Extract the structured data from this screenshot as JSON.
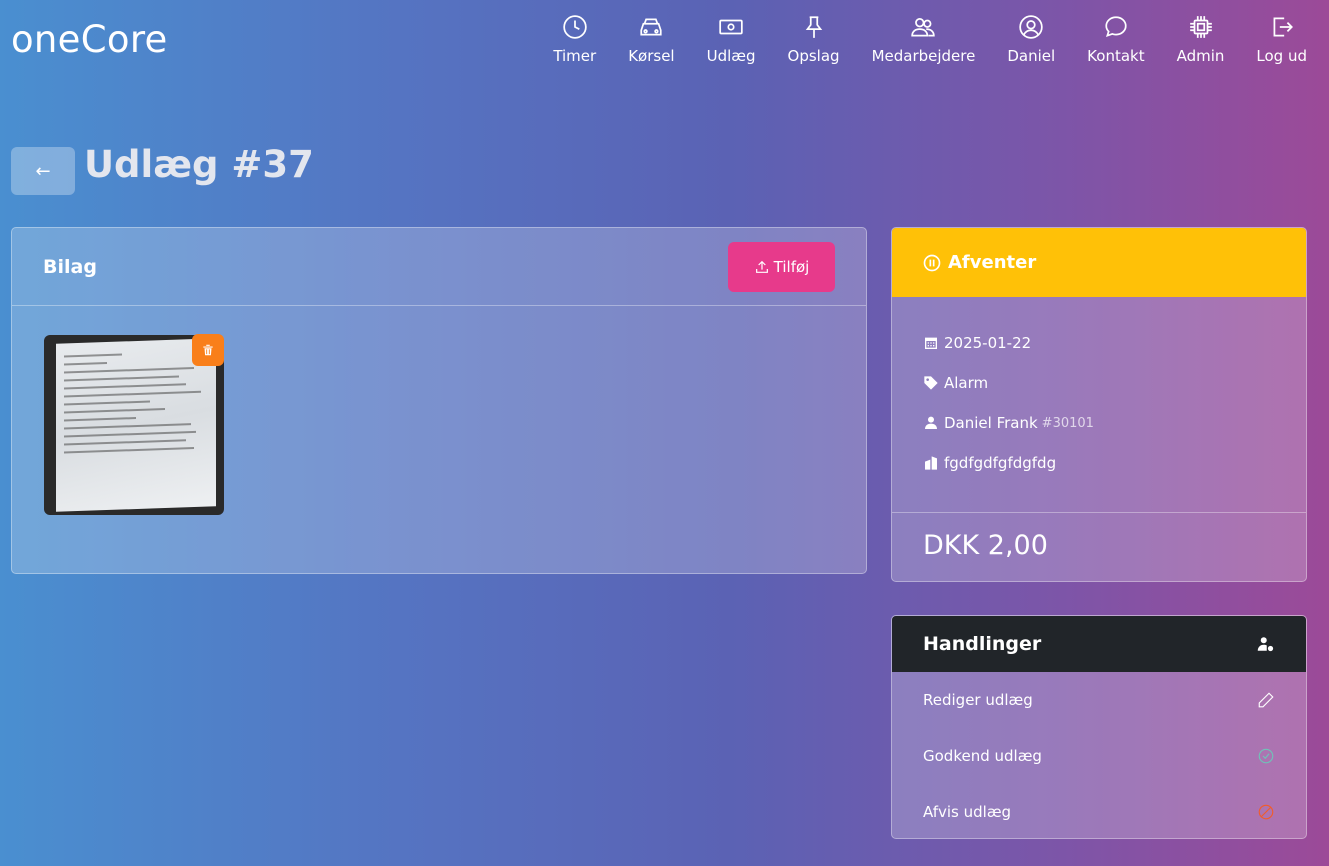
{
  "brand": "oneCore",
  "nav": [
    {
      "label": "Timer",
      "icon": "clock-icon"
    },
    {
      "label": "Kørsel",
      "icon": "car-icon"
    },
    {
      "label": "Udlæg",
      "icon": "cash-icon"
    },
    {
      "label": "Opslag",
      "icon": "pin-icon"
    },
    {
      "label": "Medarbejdere",
      "icon": "people-icon"
    },
    {
      "label": "Daniel",
      "icon": "user-circle-icon"
    },
    {
      "label": "Kontakt",
      "icon": "chat-icon"
    },
    {
      "label": "Admin",
      "icon": "cpu-icon"
    },
    {
      "label": "Log ud",
      "icon": "logout-icon"
    }
  ],
  "page": {
    "back_label": "←",
    "title": "Udlæg #37"
  },
  "bilag": {
    "title": "Bilag",
    "upload_label": "Tilføj"
  },
  "status": {
    "label": "Afventer",
    "color": "#ffc107",
    "date": "2025-01-22",
    "category": "Alarm",
    "employee_name": "Daniel Frank",
    "employee_id": "#30101",
    "company": "fgdfgdfgfdgfdg",
    "amount": "DKK 2,00"
  },
  "actions": {
    "title": "Handlinger",
    "items": [
      {
        "label": "Rediger udlæg",
        "icon": "pencil-icon",
        "color": "#ffffff"
      },
      {
        "label": "Godkend udlæg",
        "icon": "check-circle-icon",
        "color": "#6fc3b8"
      },
      {
        "label": "Afvis udlæg",
        "icon": "ban-circle-icon",
        "color": "#f25c2a"
      }
    ]
  },
  "colors": {
    "upload_button": "#e73a8b",
    "delete_button": "#f97f1a",
    "actions_header": "#212529"
  }
}
